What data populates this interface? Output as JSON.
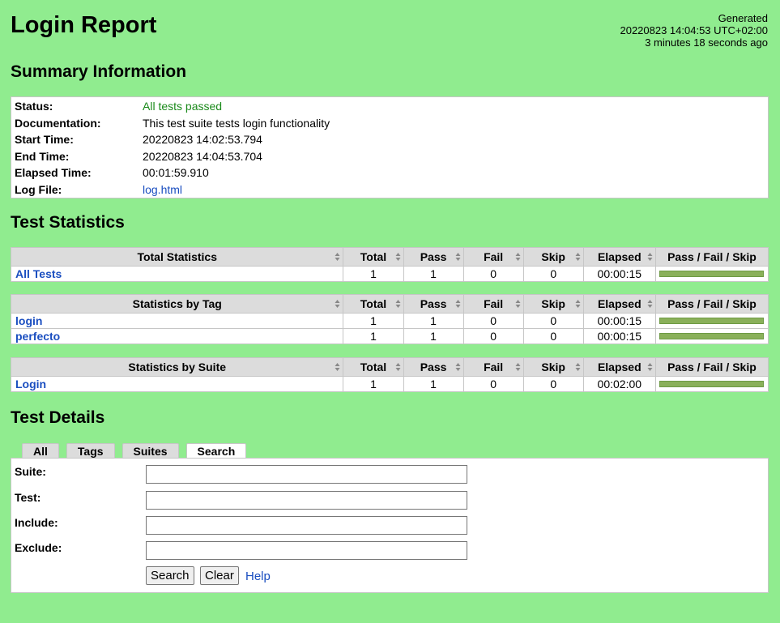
{
  "header": {
    "title": "Login Report",
    "generated_label": "Generated",
    "generated_time": "20220823 14:04:53 UTC+02:00",
    "generated_ago": "3 minutes 18 seconds ago"
  },
  "summary": {
    "heading": "Summary Information",
    "rows": [
      {
        "label": "Status:",
        "value": "All tests passed"
      },
      {
        "label": "Documentation:",
        "value": "This test suite tests login functionality"
      },
      {
        "label": "Start Time:",
        "value": "20220823 14:02:53.794"
      },
      {
        "label": "End Time:",
        "value": "20220823 14:04:53.704"
      },
      {
        "label": "Elapsed Time:",
        "value": "00:01:59.910"
      },
      {
        "label": "Log File:",
        "value": "log.html"
      }
    ]
  },
  "statistics": {
    "heading": "Test Statistics",
    "columns": [
      "Total",
      "Pass",
      "Fail",
      "Skip",
      "Elapsed",
      "Pass / Fail / Skip"
    ],
    "tables": [
      {
        "title": "Total Statistics",
        "rows": [
          {
            "name": "All Tests",
            "total": "1",
            "pass": "1",
            "fail": "0",
            "skip": "0",
            "elapsed": "00:00:15",
            "pass_ratio": 1.0
          }
        ]
      },
      {
        "title": "Statistics by Tag",
        "rows": [
          {
            "name": "login",
            "total": "1",
            "pass": "1",
            "fail": "0",
            "skip": "0",
            "elapsed": "00:00:15",
            "pass_ratio": 1.0
          },
          {
            "name": "perfecto",
            "total": "1",
            "pass": "1",
            "fail": "0",
            "skip": "0",
            "elapsed": "00:00:15",
            "pass_ratio": 1.0
          }
        ]
      },
      {
        "title": "Statistics by Suite",
        "rows": [
          {
            "name": "Login",
            "total": "1",
            "pass": "1",
            "fail": "0",
            "skip": "0",
            "elapsed": "00:02:00",
            "pass_ratio": 1.0
          }
        ]
      }
    ]
  },
  "details": {
    "heading": "Test Details",
    "tabs": [
      "All",
      "Tags",
      "Suites",
      "Search"
    ],
    "active_tab": "Search",
    "fields": [
      {
        "label": "Suite:",
        "value": ""
      },
      {
        "label": "Test:",
        "value": ""
      },
      {
        "label": "Include:",
        "value": ""
      },
      {
        "label": "Exclude:",
        "value": ""
      }
    ],
    "search_button": "Search",
    "clear_button": "Clear",
    "help_link": "Help"
  },
  "colors": {
    "background": "#90ec8f",
    "pass_bar": "#8ab05a",
    "pass_text": "#1a8a1a",
    "link": "#1a4ec0"
  }
}
